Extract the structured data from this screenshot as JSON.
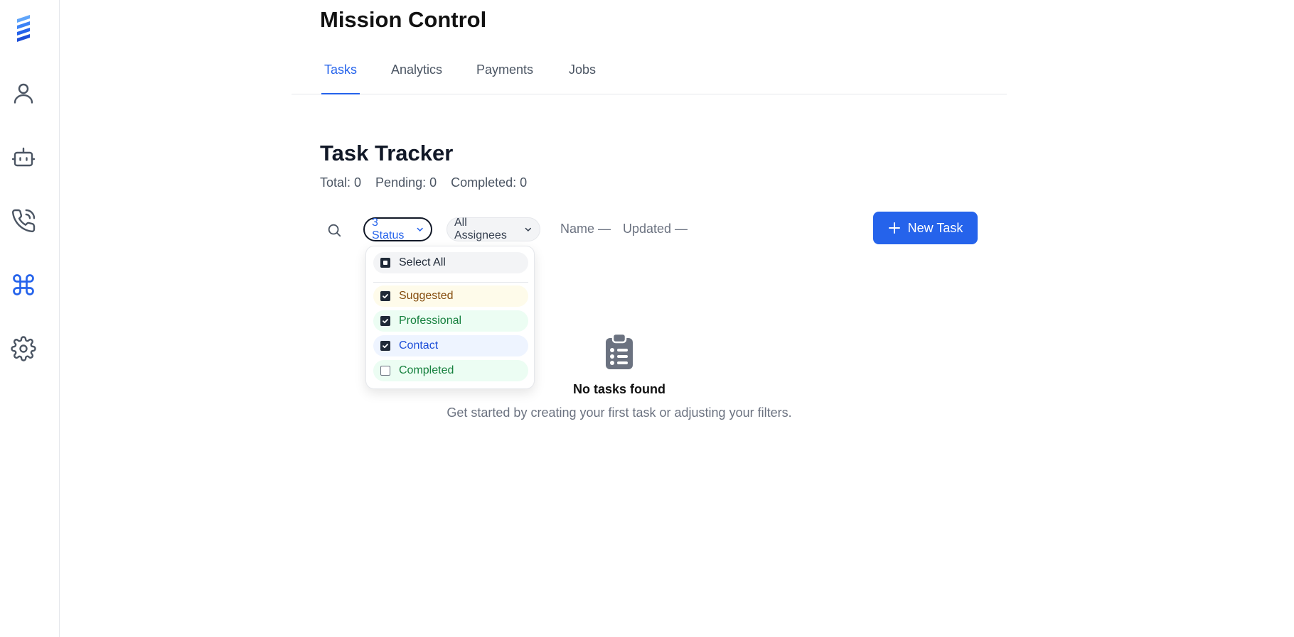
{
  "sidebar": {
    "icons": [
      "logo-icon",
      "user-icon",
      "bot-icon",
      "phone-icon",
      "command-icon",
      "gear-icon"
    ],
    "active_index": 4,
    "accent": "#2563eb"
  },
  "header": {
    "title": "Mission Control"
  },
  "tabs": [
    {
      "label": "Tasks",
      "active": true
    },
    {
      "label": "Analytics",
      "active": false
    },
    {
      "label": "Payments",
      "active": false
    },
    {
      "label": "Jobs",
      "active": false
    }
  ],
  "tracker": {
    "title": "Task Tracker",
    "stats": {
      "total": "Total: 0",
      "pending": "Pending: 0",
      "completed": "Completed: 0"
    }
  },
  "filters": {
    "status_label": "3 Status",
    "assignees_label": "All Assignees",
    "sort_name": "Name —",
    "sort_updated": "Updated —",
    "new_task_label": "New Task"
  },
  "status_dropdown": {
    "select_all": {
      "label": "Select All",
      "state": "partial"
    },
    "options": [
      {
        "label": "Suggested",
        "checked": true,
        "bg": "#fefbea",
        "color": "#854d0e"
      },
      {
        "label": "Professional",
        "checked": true,
        "bg": "#ecfdf3",
        "color": "#15803d"
      },
      {
        "label": "Contact",
        "checked": true,
        "bg": "#eef4ff",
        "color": "#1d4ed8"
      },
      {
        "label": "Completed",
        "checked": false,
        "bg": "#ecfdf3",
        "color": "#15803d"
      }
    ]
  },
  "empty_state": {
    "icon": "clipboard-list-icon",
    "title": "No tasks found",
    "subtitle": "Get started by creating your first task or adjusting your filters."
  }
}
